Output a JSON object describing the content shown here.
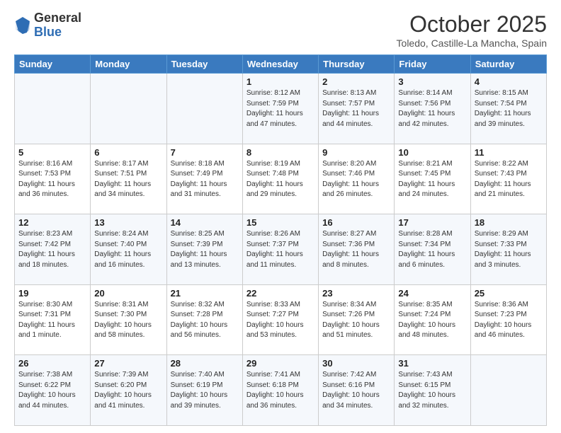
{
  "logo": {
    "general": "General",
    "blue": "Blue"
  },
  "header": {
    "month": "October 2025",
    "location": "Toledo, Castille-La Mancha, Spain"
  },
  "weekdays": [
    "Sunday",
    "Monday",
    "Tuesday",
    "Wednesday",
    "Thursday",
    "Friday",
    "Saturday"
  ],
  "weeks": [
    [
      {
        "day": "",
        "info": ""
      },
      {
        "day": "",
        "info": ""
      },
      {
        "day": "",
        "info": ""
      },
      {
        "day": "1",
        "info": "Sunrise: 8:12 AM\nSunset: 7:59 PM\nDaylight: 11 hours and 47 minutes."
      },
      {
        "day": "2",
        "info": "Sunrise: 8:13 AM\nSunset: 7:57 PM\nDaylight: 11 hours and 44 minutes."
      },
      {
        "day": "3",
        "info": "Sunrise: 8:14 AM\nSunset: 7:56 PM\nDaylight: 11 hours and 42 minutes."
      },
      {
        "day": "4",
        "info": "Sunrise: 8:15 AM\nSunset: 7:54 PM\nDaylight: 11 hours and 39 minutes."
      }
    ],
    [
      {
        "day": "5",
        "info": "Sunrise: 8:16 AM\nSunset: 7:53 PM\nDaylight: 11 hours and 36 minutes."
      },
      {
        "day": "6",
        "info": "Sunrise: 8:17 AM\nSunset: 7:51 PM\nDaylight: 11 hours and 34 minutes."
      },
      {
        "day": "7",
        "info": "Sunrise: 8:18 AM\nSunset: 7:49 PM\nDaylight: 11 hours and 31 minutes."
      },
      {
        "day": "8",
        "info": "Sunrise: 8:19 AM\nSunset: 7:48 PM\nDaylight: 11 hours and 29 minutes."
      },
      {
        "day": "9",
        "info": "Sunrise: 8:20 AM\nSunset: 7:46 PM\nDaylight: 11 hours and 26 minutes."
      },
      {
        "day": "10",
        "info": "Sunrise: 8:21 AM\nSunset: 7:45 PM\nDaylight: 11 hours and 24 minutes."
      },
      {
        "day": "11",
        "info": "Sunrise: 8:22 AM\nSunset: 7:43 PM\nDaylight: 11 hours and 21 minutes."
      }
    ],
    [
      {
        "day": "12",
        "info": "Sunrise: 8:23 AM\nSunset: 7:42 PM\nDaylight: 11 hours and 18 minutes."
      },
      {
        "day": "13",
        "info": "Sunrise: 8:24 AM\nSunset: 7:40 PM\nDaylight: 11 hours and 16 minutes."
      },
      {
        "day": "14",
        "info": "Sunrise: 8:25 AM\nSunset: 7:39 PM\nDaylight: 11 hours and 13 minutes."
      },
      {
        "day": "15",
        "info": "Sunrise: 8:26 AM\nSunset: 7:37 PM\nDaylight: 11 hours and 11 minutes."
      },
      {
        "day": "16",
        "info": "Sunrise: 8:27 AM\nSunset: 7:36 PM\nDaylight: 11 hours and 8 minutes."
      },
      {
        "day": "17",
        "info": "Sunrise: 8:28 AM\nSunset: 7:34 PM\nDaylight: 11 hours and 6 minutes."
      },
      {
        "day": "18",
        "info": "Sunrise: 8:29 AM\nSunset: 7:33 PM\nDaylight: 11 hours and 3 minutes."
      }
    ],
    [
      {
        "day": "19",
        "info": "Sunrise: 8:30 AM\nSunset: 7:31 PM\nDaylight: 11 hours and 1 minute."
      },
      {
        "day": "20",
        "info": "Sunrise: 8:31 AM\nSunset: 7:30 PM\nDaylight: 10 hours and 58 minutes."
      },
      {
        "day": "21",
        "info": "Sunrise: 8:32 AM\nSunset: 7:28 PM\nDaylight: 10 hours and 56 minutes."
      },
      {
        "day": "22",
        "info": "Sunrise: 8:33 AM\nSunset: 7:27 PM\nDaylight: 10 hours and 53 minutes."
      },
      {
        "day": "23",
        "info": "Sunrise: 8:34 AM\nSunset: 7:26 PM\nDaylight: 10 hours and 51 minutes."
      },
      {
        "day": "24",
        "info": "Sunrise: 8:35 AM\nSunset: 7:24 PM\nDaylight: 10 hours and 48 minutes."
      },
      {
        "day": "25",
        "info": "Sunrise: 8:36 AM\nSunset: 7:23 PM\nDaylight: 10 hours and 46 minutes."
      }
    ],
    [
      {
        "day": "26",
        "info": "Sunrise: 7:38 AM\nSunset: 6:22 PM\nDaylight: 10 hours and 44 minutes."
      },
      {
        "day": "27",
        "info": "Sunrise: 7:39 AM\nSunset: 6:20 PM\nDaylight: 10 hours and 41 minutes."
      },
      {
        "day": "28",
        "info": "Sunrise: 7:40 AM\nSunset: 6:19 PM\nDaylight: 10 hours and 39 minutes."
      },
      {
        "day": "29",
        "info": "Sunrise: 7:41 AM\nSunset: 6:18 PM\nDaylight: 10 hours and 36 minutes."
      },
      {
        "day": "30",
        "info": "Sunrise: 7:42 AM\nSunset: 6:16 PM\nDaylight: 10 hours and 34 minutes."
      },
      {
        "day": "31",
        "info": "Sunrise: 7:43 AM\nSunset: 6:15 PM\nDaylight: 10 hours and 32 minutes."
      },
      {
        "day": "",
        "info": ""
      }
    ]
  ]
}
